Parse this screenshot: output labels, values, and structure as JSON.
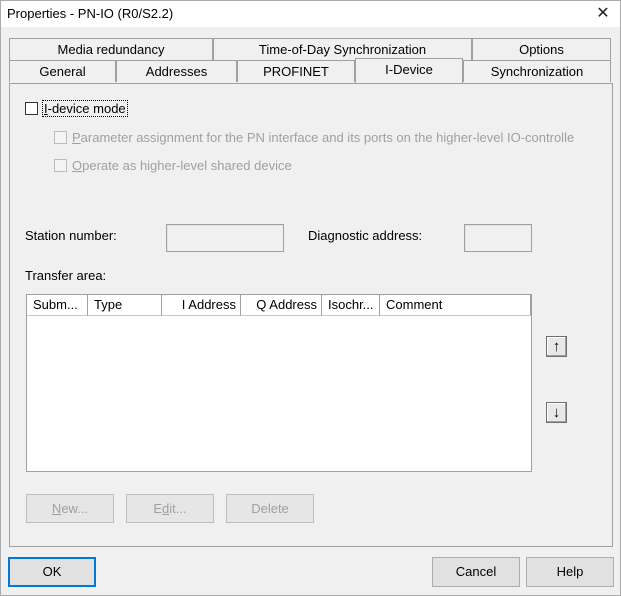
{
  "window": {
    "title": "Properties - PN-IO (R0/S2.2)",
    "close_glyph": "✕"
  },
  "tabs": {
    "row1": [
      "Media redundancy",
      "Time-of-Day Synchronization",
      "Options"
    ],
    "row2": [
      "General",
      "Addresses",
      "PROFINET",
      "I-Device",
      "Synchronization"
    ],
    "active": "I-Device"
  },
  "idevice": {
    "mode_label_u": "I",
    "mode_label_rest": "-device mode",
    "param_label_u": "P",
    "param_label_rest": "arameter assignment for the PN interface and its ports on the higher-level IO-controlle",
    "shared_label_u": "O",
    "shared_label_rest": "perate as higher-level shared device"
  },
  "fields": {
    "station_number_label": "Station number:",
    "station_number_value": "",
    "diagnostic_address_label": "Diagnostic address:",
    "diagnostic_address_value": ""
  },
  "transfer_area": {
    "label": "Transfer area:",
    "columns": [
      "Subm...",
      "Type",
      "I Address",
      "Q Address",
      "Isochr...",
      "Comment"
    ],
    "rows": []
  },
  "scroll_icons": {
    "up": "↑",
    "down": "↓"
  },
  "panel_buttons": {
    "new_u": "N",
    "new_rest": "ew...",
    "edit_pre": "E",
    "edit_u": "d",
    "edit_rest": "it...",
    "delete": "Delete"
  },
  "footer": {
    "ok": "OK",
    "cancel": "Cancel",
    "help": "Help"
  }
}
